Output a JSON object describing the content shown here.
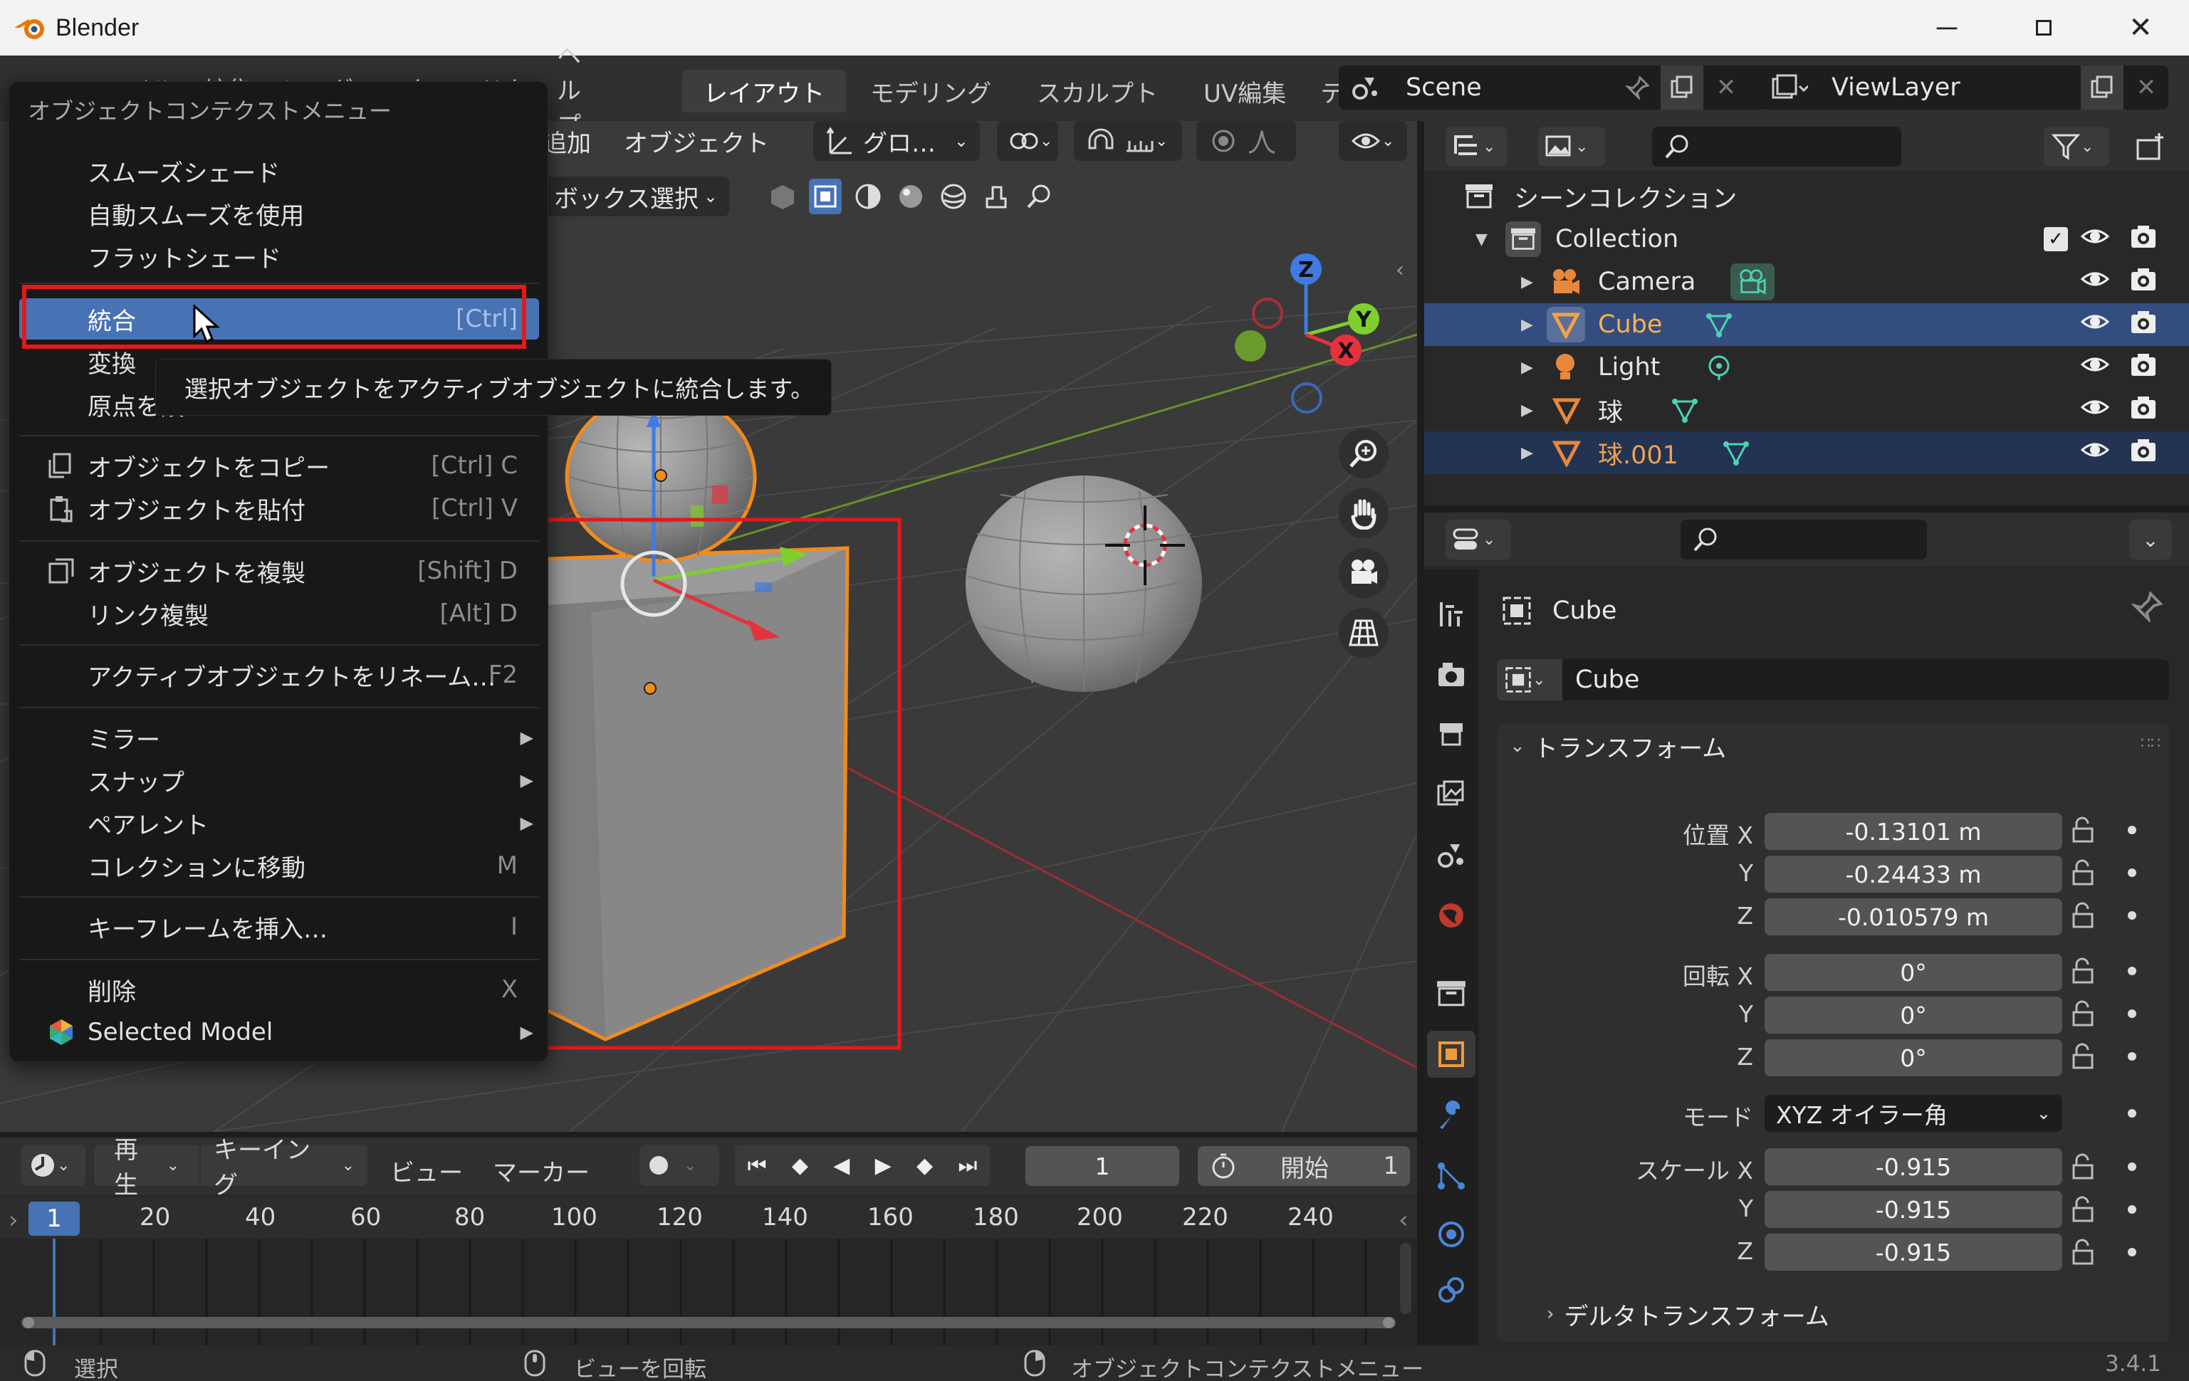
{
  "window": {
    "app_title": "Blender",
    "version": "3.4.1"
  },
  "topbar": {
    "menus": [
      "ファイル",
      "編集",
      "レンダー",
      "ウィンドウ",
      "ヘルプ"
    ],
    "workspace_tabs": [
      "レイアウト",
      "モデリング",
      "スカルプト",
      "UV編集",
      "テ"
    ],
    "active_tab": "レイアウト",
    "scene": "Scene",
    "view_layer": "ViewLayer"
  },
  "viewport_header": {
    "add_menu": "追加",
    "object_menu": "オブジェクト",
    "transform_orientation": "グロ…",
    "select_mode": "ボックス選択"
  },
  "context_menu": {
    "title": "オブジェクトコンテクストメニュー",
    "items": [
      {
        "label": "スムーズシェード",
        "shortcut": ""
      },
      {
        "label": "自動スムーズを使用",
        "shortcut": ""
      },
      {
        "label": "フラットシェード",
        "shortcut": ""
      },
      {
        "label": "統合",
        "shortcut": "[Ctrl]"
      },
      {
        "label": "変換",
        "shortcut": ""
      },
      {
        "label": "原点を設",
        "shortcut": ""
      },
      {
        "label": "オブジェクトをコピー",
        "shortcut": "[Ctrl] C"
      },
      {
        "label": "オブジェクトを貼付",
        "shortcut": "[Ctrl] V"
      },
      {
        "label": "オブジェクトを複製",
        "shortcut": "[Shift] D"
      },
      {
        "label": "リンク複製",
        "shortcut": "[Alt] D"
      },
      {
        "label": "アクティブオブジェクトをリネーム…",
        "shortcut": "F2"
      },
      {
        "label": "ミラー",
        "shortcut": ""
      },
      {
        "label": "スナップ",
        "shortcut": ""
      },
      {
        "label": "ペアレント",
        "shortcut": ""
      },
      {
        "label": "コレクションに移動",
        "shortcut": "M"
      },
      {
        "label": "キーフレームを挿入…",
        "shortcut": "I"
      },
      {
        "label": "削除",
        "shortcut": "X"
      },
      {
        "label": "Selected Model",
        "shortcut": ""
      }
    ],
    "highlighted": "統合"
  },
  "tooltip": {
    "text": "選択オブジェクトをアクティブオブジェクトに統合します。"
  },
  "outliner": {
    "scene_collection": "シーンコレクション",
    "collection": "Collection",
    "objects": [
      "Camera",
      "Cube",
      "Light",
      "球",
      "球.001"
    ]
  },
  "properties": {
    "object_name": "Cube",
    "data_name": "Cube",
    "panel_transform": "トランスフォーム",
    "location_label": "位置",
    "rotation_label": "回転",
    "mode_label": "モード",
    "scale_label": "スケール",
    "axis": {
      "x": "X",
      "y": "Y",
      "z": "Z"
    },
    "location": {
      "x": "-0.13101 m",
      "y": "-0.24433 m",
      "z": "-0.010579 m"
    },
    "rotation": {
      "x": "0°",
      "y": "0°",
      "z": "0°"
    },
    "rotation_mode": "XYZ オイラー角",
    "scale": {
      "x": "-0.915",
      "y": "-0.915",
      "z": "-0.915"
    },
    "panel_delta": "デルタトランスフォーム"
  },
  "timeline": {
    "playback": "再生",
    "keying": "キーイング",
    "view": "ビュー",
    "marker": "マーカー",
    "current_frame": "1",
    "start_label": "開始",
    "start_value": "1",
    "ruler": [
      "1",
      "20",
      "40",
      "60",
      "80",
      "100",
      "120",
      "140",
      "160",
      "180",
      "200",
      "220",
      "240"
    ]
  },
  "statusbar": {
    "select": "選択",
    "rotate_view": "ビューを回転",
    "context_menu": "オブジェクトコンテクストメニュー"
  },
  "colors": {
    "highlight": "#4772b3",
    "selected_orange": "#ff8e27",
    "annotation_red": "#e2191c",
    "outliner_select": "#334d80"
  }
}
